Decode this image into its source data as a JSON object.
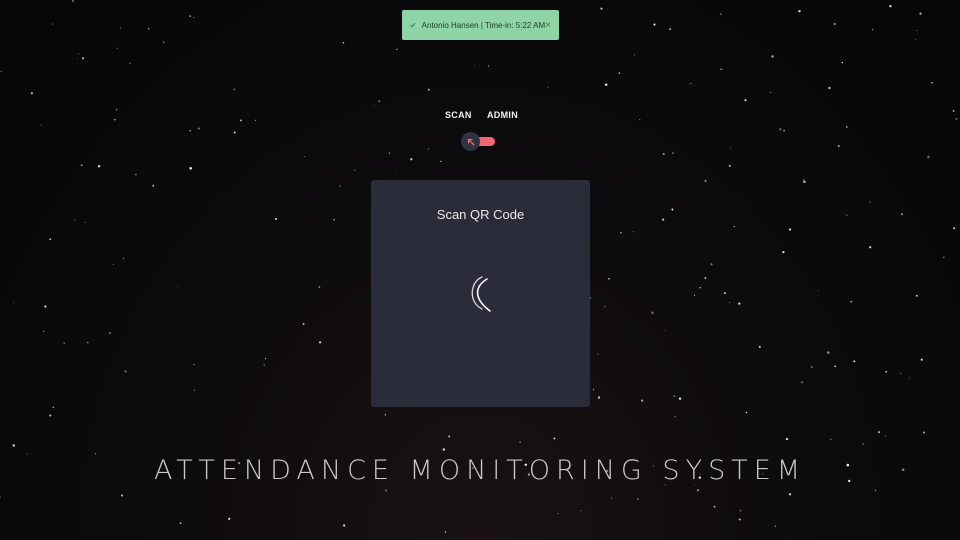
{
  "toast": {
    "message": "Antonio Hansen | Time-in: 5:22 AM",
    "close_symbol": "×",
    "icon": "check-icon",
    "background": "#8ed4a4"
  },
  "mode_switch": {
    "left_label": "SCAN",
    "right_label": "ADMIN",
    "knob_icon": "arrow-up-left-icon",
    "track_color": "#f26672"
  },
  "scanner": {
    "title": "Scan QR Code",
    "status_icon": "loading-spinner-icon"
  },
  "app": {
    "title": "ATTENDANCE MONITORING SYSTEM"
  },
  "theme": {
    "background": "#0b0a0c",
    "card": "#2a2c3a"
  }
}
